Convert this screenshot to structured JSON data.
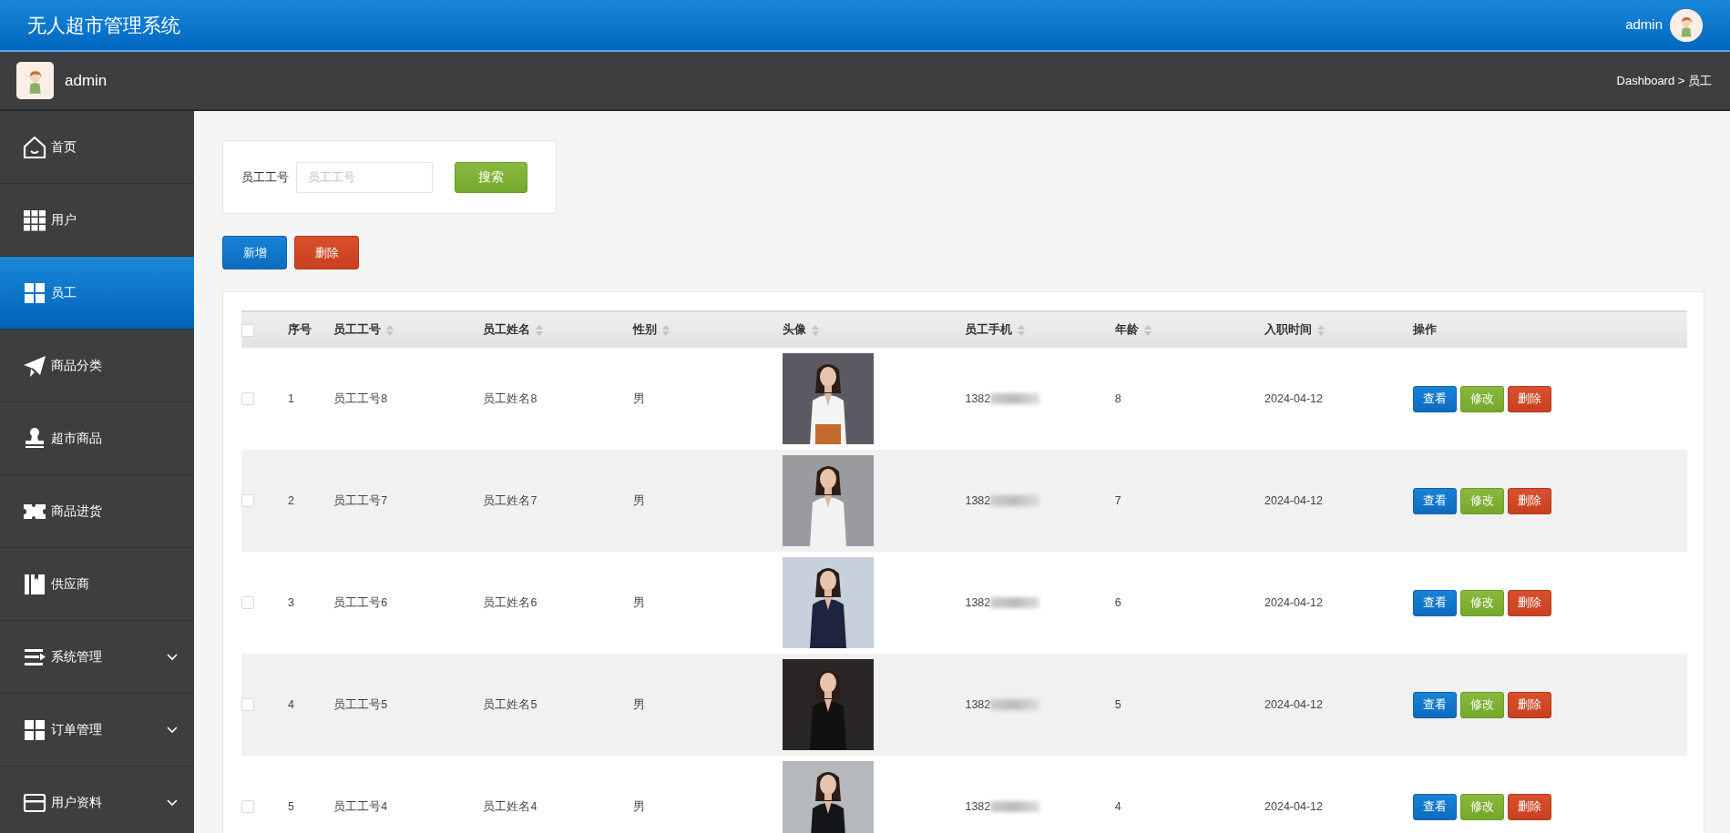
{
  "header": {
    "title": "无人超市管理系统",
    "user": "admin"
  },
  "subbar": {
    "user": "admin",
    "breadcrumb": "Dashboard > 员工"
  },
  "sidebar": {
    "items": [
      {
        "label": "首页",
        "kind": "link",
        "selected": false
      },
      {
        "label": "用户",
        "kind": "link",
        "selected": false
      },
      {
        "label": "员工",
        "kind": "link",
        "selected": true
      },
      {
        "label": "商品分类",
        "kind": "link",
        "selected": false
      },
      {
        "label": "超市商品",
        "kind": "link",
        "selected": false
      },
      {
        "label": "商品进货",
        "kind": "link",
        "selected": false
      },
      {
        "label": "供应商",
        "kind": "link",
        "selected": false
      },
      {
        "label": "系统管理",
        "kind": "menu",
        "selected": false
      },
      {
        "label": "订单管理",
        "kind": "menu",
        "selected": false
      },
      {
        "label": "用户资料",
        "kind": "menu",
        "selected": false
      }
    ]
  },
  "search": {
    "label": "员工工号",
    "placeholder": "员工工号",
    "button": "搜索"
  },
  "actions": [
    "新增",
    "删除"
  ],
  "table": {
    "select_all": {
      "checked": false
    },
    "columns": [
      {
        "label": "序号",
        "sortable": false
      },
      {
        "label": "员工工号",
        "sortable": true
      },
      {
        "label": "员工姓名",
        "sortable": true
      },
      {
        "label": "性别",
        "sortable": true
      },
      {
        "label": "头像",
        "sortable": true
      },
      {
        "label": "员工手机",
        "sortable": true
      },
      {
        "label": "年龄",
        "sortable": true
      },
      {
        "label": "入职时间",
        "sortable": true
      },
      {
        "label": "操作",
        "sortable": false
      }
    ],
    "rows": [
      {
        "checked": false,
        "index": "1",
        "id": "员工工号8",
        "name": "员工姓名8",
        "gender": "男",
        "phone": "1382",
        "age": "8",
        "date": "2024-04-12",
        "buttons": [
          "查看",
          "修改",
          "删除"
        ]
      },
      {
        "checked": false,
        "index": "2",
        "id": "员工工号7",
        "name": "员工姓名7",
        "gender": "男",
        "phone": "1382",
        "age": "7",
        "date": "2024-04-12",
        "buttons": [
          "查看",
          "修改",
          "删除"
        ]
      },
      {
        "checked": false,
        "index": "3",
        "id": "员工工号6",
        "name": "员工姓名6",
        "gender": "男",
        "phone": "1382",
        "age": "6",
        "date": "2024-04-12",
        "buttons": [
          "查看",
          "修改",
          "删除"
        ]
      },
      {
        "checked": false,
        "index": "4",
        "id": "员工工号5",
        "name": "员工姓名5",
        "gender": "男",
        "phone": "1382",
        "age": "5",
        "date": "2024-04-12",
        "buttons": [
          "查看",
          "修改",
          "删除"
        ]
      },
      {
        "checked": false,
        "index": "5",
        "id": "员工工号4",
        "name": "员工姓名4",
        "gender": "男",
        "phone": "1382",
        "age": "4",
        "date": "2024-04-12",
        "buttons": [
          "查看",
          "修改",
          "删除"
        ]
      }
    ]
  }
}
